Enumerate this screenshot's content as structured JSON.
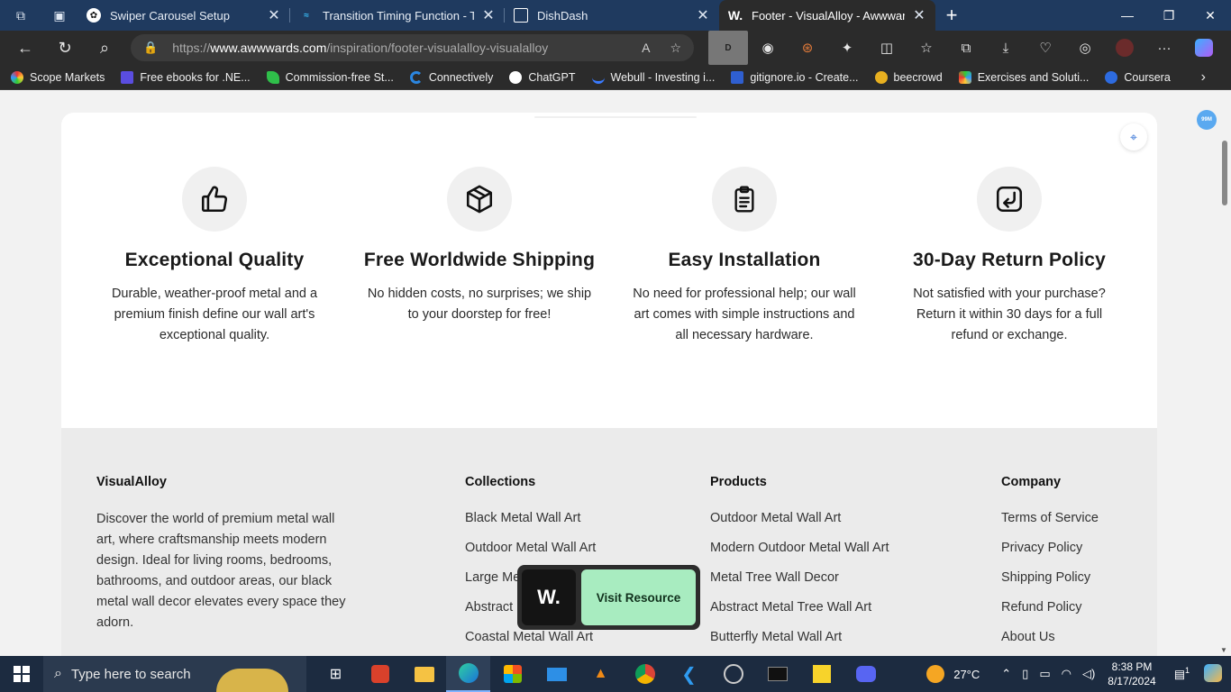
{
  "browser": {
    "tabs": [
      {
        "title": "Swiper Carousel Setup",
        "active": false
      },
      {
        "title": "Transition Timing Function - Tailw",
        "active": false
      },
      {
        "title": "DishDash",
        "active": false
      },
      {
        "title": "Footer - VisualAlloy - Awwwards",
        "active": true
      }
    ],
    "active_tab_icon": "W.",
    "url_prefix": "https://",
    "url_domain": "www.awwwards.com",
    "url_path": "/inspiration/footer-visualalloy-visualalloy",
    "bookmarks": [
      "Scope Markets",
      "Free ebooks for .NE...",
      "Commission-free St...",
      "Connectively",
      "ChatGPT",
      "Webull - Investing i...",
      "gitignore.io - Create...",
      "beecrowd",
      "Exercises and Soluti...",
      "Coursera"
    ],
    "extension_badge": "99M"
  },
  "features": [
    {
      "icon": "thumbs-up-icon",
      "title": "Exceptional Quality",
      "text": "Durable, weather-proof metal and a premium finish define our wall art's exceptional quality."
    },
    {
      "icon": "box-icon",
      "title": "Free Worldwide Shipping",
      "text": "No hidden costs, no surprises; we ship to your doorstep for free!"
    },
    {
      "icon": "clipboard-icon",
      "title": "Easy Installation",
      "text": "No need for professional help; our wall art comes with simple instructions and all necessary hardware."
    },
    {
      "icon": "return-icon",
      "title": "30-Day Return Policy",
      "text": "Not satisfied with your purchase? Return it within 30 days for a full refund or exchange."
    }
  ],
  "footer": {
    "brand": {
      "name": "VisualAlloy",
      "description": "Discover the world of premium metal wall art, where craftsmanship meets modern design. Ideal for living rooms, bedrooms, bathrooms, and outdoor areas, our black metal wall decor elevates every space they adorn."
    },
    "collections": {
      "heading": "Collections",
      "items": [
        "Black Metal Wall Art",
        "Outdoor Metal Wall Art",
        "Large Me",
        "Abstract",
        "Coastal Metal Wall Art"
      ]
    },
    "products": {
      "heading": "Products",
      "items": [
        "Outdoor Metal Wall Art",
        "Modern Outdoor Metal Wall Art",
        "Metal Tree Wall Decor",
        "Abstract Metal Tree Wall Art",
        "Butterfly Metal Wall Art"
      ]
    },
    "company": {
      "heading": "Company",
      "items": [
        "Terms of Service",
        "Privacy Policy",
        "Shipping Policy",
        "Refund Policy",
        "About Us"
      ]
    }
  },
  "visit_popup": {
    "logo": "W.",
    "button": "Visit Resource"
  },
  "taskbar": {
    "search_placeholder": "Type here to search",
    "weather": "27°C",
    "time": "8:38 PM",
    "date": "8/17/2024",
    "notification_count": "1"
  },
  "colors": {
    "accent_green": "#a8ecc0",
    "tab_bar": "#1f3a5f",
    "card_bg": "#ffffff",
    "footer_bg": "#ebebeb"
  }
}
